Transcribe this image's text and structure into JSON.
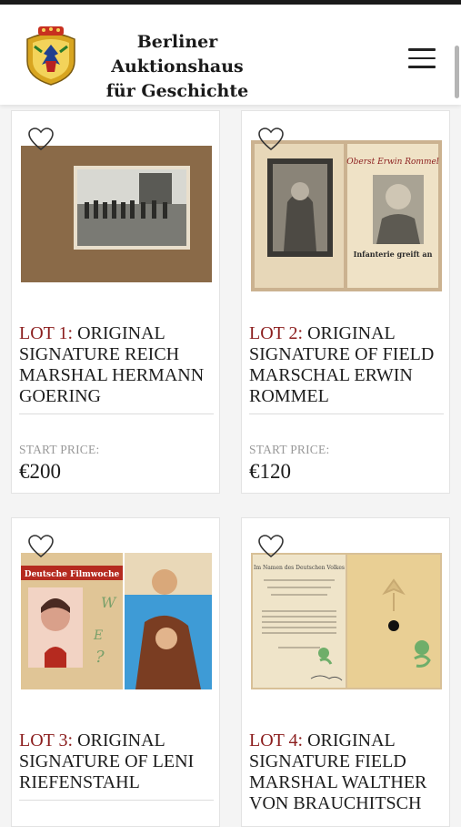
{
  "site": {
    "name_line1": "Berliner Auktionshaus",
    "name_line2": "für Geschichte",
    "logo": "crest-logo",
    "menu_icon": "hamburger-menu-icon"
  },
  "colors": {
    "lot_accent": "#8b1d1d",
    "page_bg": "#f4f4f4"
  },
  "lots": [
    {
      "lot_label": "LOT 1:",
      "title": "ORIGINAL SIGNATURE REICH MARSHAL HERMANN GOERING",
      "price_label": "START PRICE:",
      "price": "€200",
      "image_text": ""
    },
    {
      "lot_label": "LOT 2:",
      "title": "ORIGINAL SIGNATURE OF FIELD MARSCHAL ERWIN ROMMEL",
      "price_label": "START PRICE:",
      "price": "€120",
      "image_text": "Oberst Erwin Rommel",
      "image_text2": "Infanterie greift an"
    },
    {
      "lot_label": "LOT 3:",
      "title": "ORIGINAL SIGNATURE OF LENI RIEFENSTAHL",
      "image_text": "Deutsche Filmwoche"
    },
    {
      "lot_label": "LOT 4:",
      "title": "ORIGINAL SIGNATURE FIELD MARSHAL WALTHER VON BRAUCHITSCH",
      "image_text": "Im Namen des Deutschen Volkes"
    }
  ]
}
